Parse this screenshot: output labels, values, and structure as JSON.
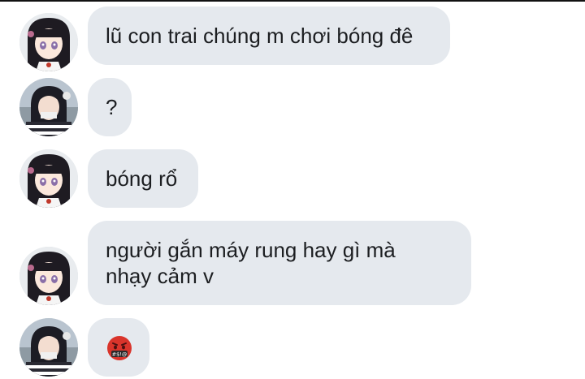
{
  "messages": [
    {
      "sender": "kanao",
      "text": "lũ con trai chúng m chơi bóng đê"
    },
    {
      "sender": "obanai",
      "text": "?"
    },
    {
      "sender": "kanao",
      "text": "bóng rổ"
    },
    {
      "sender": "kanao",
      "lines": [
        "người gắn máy rung hay gì mà",
        "nhạy cảm v"
      ]
    },
    {
      "sender": "obanai",
      "emoji": "face-with-symbols-on-mouth"
    }
  ],
  "colors": {
    "bubble": "#e5e9ee",
    "text": "#1c1e21"
  }
}
